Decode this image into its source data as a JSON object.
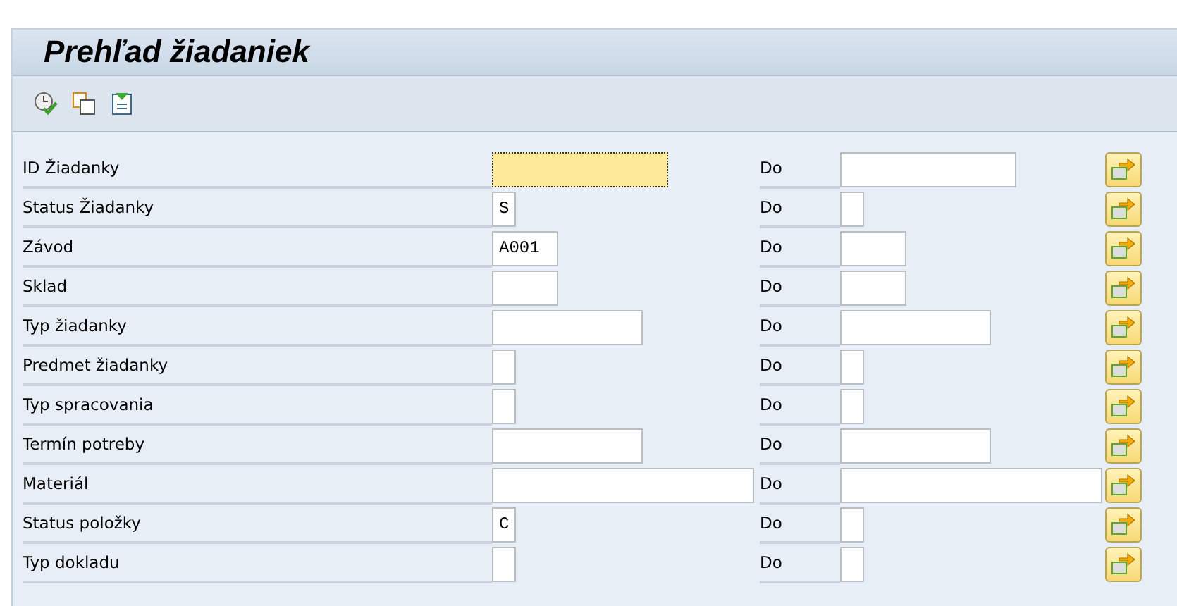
{
  "title": "Prehľad žiadaniek",
  "rows": [
    {
      "label": "ID Žiadanky",
      "kind": "id",
      "low": {
        "focused": true
      },
      "to_label": "Do",
      "high": {
        "focused": false
      }
    },
    {
      "label": "Status Žiadanky",
      "kind": "single",
      "low": {
        "value": "S",
        "focused": false
      },
      "to_label": "Do",
      "high": {
        "focused": false
      }
    },
    {
      "label": "Závod",
      "kind": "short",
      "low": {
        "value": "A001",
        "focused": false
      },
      "to_label": "Do",
      "high": {
        "focused": false
      }
    },
    {
      "label": "Sklad",
      "kind": "short",
      "low": {
        "focused": false
      },
      "to_label": "Do",
      "high": {
        "focused": false
      }
    },
    {
      "label": "Typ žiadanky",
      "kind": "medium",
      "low": {
        "focused": false
      },
      "to_label": "Do",
      "high": {
        "focused": false
      }
    },
    {
      "label": "Predmet žiadanky",
      "kind": "single",
      "low": {
        "focused": false
      },
      "to_label": "Do",
      "high": {
        "focused": false
      }
    },
    {
      "label": "Typ spracovania",
      "kind": "single",
      "low": {
        "focused": false
      },
      "to_label": "Do",
      "high": {
        "focused": false
      }
    },
    {
      "label": "Termín potreby",
      "kind": "medium",
      "low": {
        "focused": false
      },
      "to_label": "Do",
      "high": {
        "focused": false
      }
    },
    {
      "label": "Materiál",
      "kind": "wide",
      "low": {
        "focused": false
      },
      "to_label": "Do",
      "high": {
        "focused": false
      }
    },
    {
      "label": "Status položky",
      "kind": "single",
      "low": {
        "value": "C",
        "focused": false
      },
      "to_label": "Do",
      "high": {
        "focused": false
      }
    },
    {
      "label": "Typ dokladu",
      "kind": "single",
      "low": {
        "focused": false
      },
      "to_label": "Do",
      "high": {
        "focused": false
      }
    }
  ]
}
